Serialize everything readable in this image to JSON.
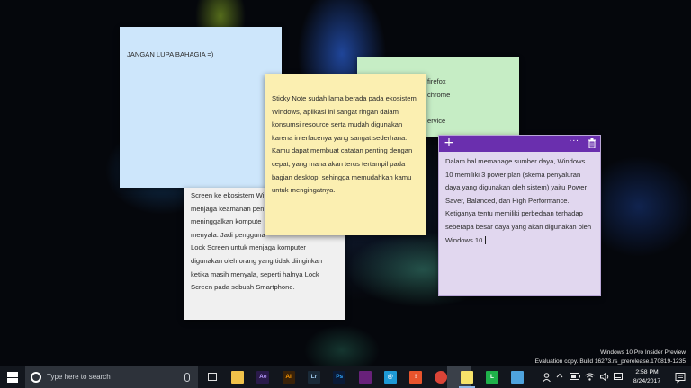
{
  "notes": {
    "blue": {
      "text": "JANGAN LUPA BAHAGIA =)"
    },
    "green": {
      "lines": [
        "firefox",
        "chrome",
        "",
        "ervice"
      ]
    },
    "gray": {
      "lines": [
        "Screen ke ekosistem Wi",
        "menjaga keamanan pen",
        "meninggalkan kompute",
        "menyala. Jadi pengguna",
        "Lock Screen untuk menjaga komputer",
        "digunakan oleh orang yang tidak diinginkan",
        "ketika masih menyala, seperti halnya Lock",
        "Screen pada sebuah Smartphone."
      ]
    },
    "yellow": {
      "lines": [
        "Sticky Note sudah lama berada pada ekosistem",
        "Windows, aplikasi ini sangat ringan dalam",
        "konsumsi resource serta mudah digunakan",
        "karena interfacenya yang sangat sederhana.",
        "Kamu dapat membuat catatan penting dengan",
        "cepat, yang mana akan terus tertampil pada",
        "bagian desktop, sehingga memudahkan kamu",
        "untuk mengingatnya."
      ]
    },
    "purple": {
      "header": {
        "add_glyph": "+",
        "more_glyph": "···"
      },
      "lines": [
        "Dalam hal memanage sumber daya, Windows",
        "10 memiliki 3 power plan (skema penyaluran",
        "daya yang digunakan oleh sistem) yaitu Power",
        "Saver, Balanced, dan High Performance.",
        "Ketiganya tentu memiliki perbedaan terhadap",
        "seberapa besar daya yang akan digunakan oleh",
        "Windows 10."
      ],
      "header_color": "#6a2fae"
    }
  },
  "watermark": {
    "line1": "Windows 10 Pro Insider Preview",
    "line2": "Evaluation copy. Build 16273.rs_prerelease.170819-1235"
  },
  "taskbar": {
    "search_placeholder": "Type here to search",
    "apps": [
      {
        "name": "file-explorer",
        "label": "",
        "bg": "#f0c24a",
        "fg": "#8a5a00"
      },
      {
        "name": "after-effects",
        "label": "Ae",
        "bg": "#2a1a4a",
        "fg": "#b99cff"
      },
      {
        "name": "illustrator",
        "label": "Ai",
        "bg": "#3a2208",
        "fg": "#ff9a00"
      },
      {
        "name": "lightroom",
        "label": "Lr",
        "bg": "#1a2a38",
        "fg": "#9fc8ea"
      },
      {
        "name": "photoshop",
        "label": "Ps",
        "bg": "#0a1a36",
        "fg": "#31a8ff"
      },
      {
        "name": "visual-studio",
        "label": "",
        "bg": "#68217a",
        "fg": "#ffffff"
      },
      {
        "name": "mail",
        "label": "@",
        "bg": "#1e9ad6",
        "fg": "#ffffff"
      },
      {
        "name": "app-orange",
        "label": "!",
        "bg": "#e8542c",
        "fg": "#ffffff"
      },
      {
        "name": "chrome",
        "label": "",
        "bg": "#db4437",
        "fg": "#ffffff"
      },
      {
        "name": "sticky-notes",
        "label": "",
        "bg": "#f7e36a",
        "fg": "#6b5a00"
      },
      {
        "name": "line",
        "label": "L",
        "bg": "#1fb14a",
        "fg": "#ffffff"
      },
      {
        "name": "app-blue",
        "label": "",
        "bg": "#4ea3dd",
        "fg": "#ffffff"
      }
    ],
    "clock": {
      "time": "2:58 PM",
      "date": "8/24/2017"
    }
  }
}
